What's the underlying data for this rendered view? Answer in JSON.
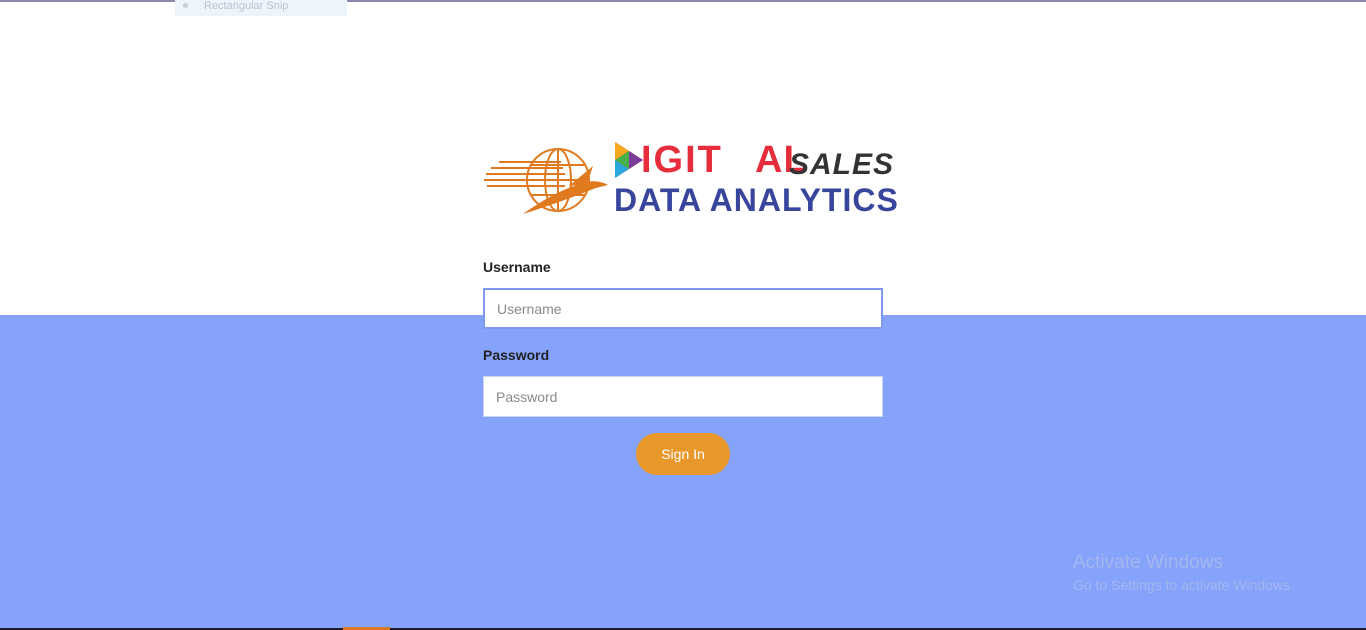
{
  "snip": {
    "label": "Rectangular Snip"
  },
  "logo": {
    "brand_part1": "IGIT",
    "brand_part2": "AL",
    "brand_part3": "SALES",
    "brand_sub": "DATA ANALYTICS"
  },
  "form": {
    "username_label": "Username",
    "username_placeholder": "Username",
    "username_value": "",
    "password_label": "Password",
    "password_placeholder": "Password",
    "password_value": "",
    "signin_label": "Sign In"
  },
  "watermark": {
    "line1": "Activate Windows",
    "line2": "Go to Settings to activate Windows."
  },
  "colors": {
    "accent_bg": "#86a3fc",
    "button": "#e8982a",
    "brand_red": "#e52d3b",
    "brand_blue": "#38459c",
    "logo_orange": "#e07a1f"
  },
  "icons": [
    "globe-bird-icon",
    "play-icon",
    "radio-dot-icon"
  ]
}
